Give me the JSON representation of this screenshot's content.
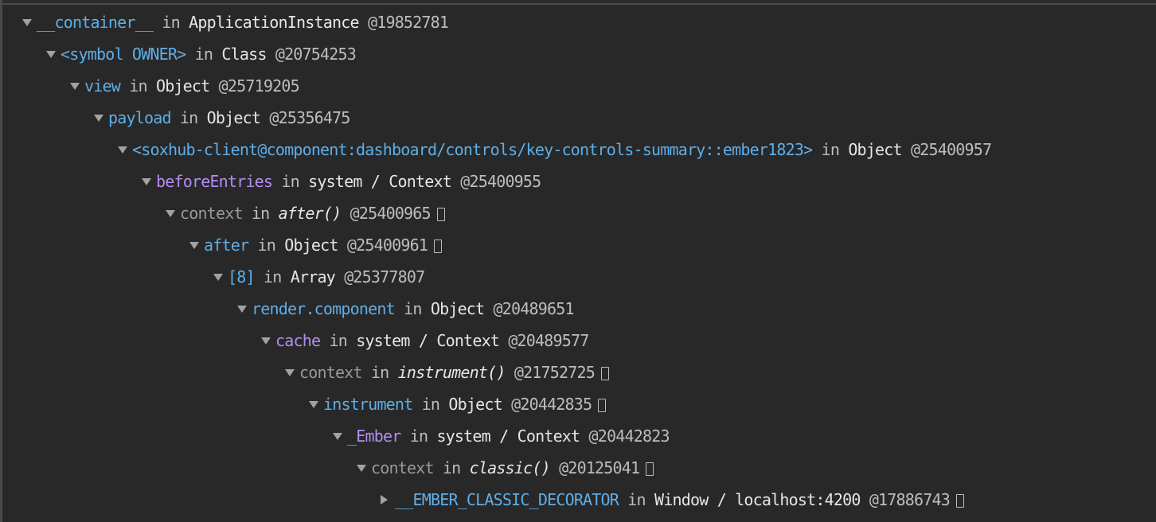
{
  "tree": [
    {
      "state": "open",
      "name": "__container__",
      "name_color": "blue",
      "in": "in",
      "type": "ApplicationInstance",
      "type_italic": false,
      "id": "@19852781",
      "reveal": false
    },
    {
      "state": "open",
      "name": "<symbol OWNER>",
      "name_color": "blue",
      "in": "in",
      "type": "Class",
      "type_italic": false,
      "id": "@20754253",
      "reveal": false
    },
    {
      "state": "open",
      "name": "view",
      "name_color": "blue",
      "in": "in",
      "type": "Object",
      "type_italic": false,
      "id": "@25719205",
      "reveal": false
    },
    {
      "state": "open",
      "name": "payload",
      "name_color": "blue",
      "in": "in",
      "type": "Object",
      "type_italic": false,
      "id": "@25356475",
      "reveal": false
    },
    {
      "state": "open",
      "name": "<soxhub-client@component:dashboard/controls/key-controls-summary::ember1823>",
      "name_color": "blue",
      "in": "in",
      "type": "Object",
      "type_italic": false,
      "id": "@25400957",
      "reveal": false
    },
    {
      "state": "open",
      "name": "beforeEntries",
      "name_color": "purple",
      "in": "in",
      "type": "system / Context",
      "type_italic": false,
      "id": "@25400955",
      "reveal": false
    },
    {
      "state": "open",
      "name": "context",
      "name_color": "gray",
      "in": "in",
      "type": "after()",
      "type_italic": true,
      "id": "@25400965",
      "reveal": true
    },
    {
      "state": "open",
      "name": "after",
      "name_color": "blue",
      "in": "in",
      "type": "Object",
      "type_italic": false,
      "id": "@25400961",
      "reveal": true
    },
    {
      "state": "open",
      "name": "[8]",
      "name_color": "blue",
      "in": "in",
      "type": "Array",
      "type_italic": false,
      "id": "@25377807",
      "reveal": false
    },
    {
      "state": "open",
      "name": "render.component",
      "name_color": "blue",
      "in": "in",
      "type": "Object",
      "type_italic": false,
      "id": "@20489651",
      "reveal": false
    },
    {
      "state": "open",
      "name": "cache",
      "name_color": "purple",
      "in": "in",
      "type": "system / Context",
      "type_italic": false,
      "id": "@20489577",
      "reveal": false
    },
    {
      "state": "open",
      "name": "context",
      "name_color": "gray",
      "in": "in",
      "type": "instrument()",
      "type_italic": true,
      "id": "@21752725",
      "reveal": true
    },
    {
      "state": "open",
      "name": "instrument",
      "name_color": "blue",
      "in": "in",
      "type": "Object",
      "type_italic": false,
      "id": "@20442835",
      "reveal": true
    },
    {
      "state": "open",
      "name": "_Ember",
      "name_color": "purple",
      "in": "in",
      "type": "system / Context",
      "type_italic": false,
      "id": "@20442823",
      "reveal": false
    },
    {
      "state": "open",
      "name": "context",
      "name_color": "gray",
      "in": "in",
      "type": "classic()",
      "type_italic": true,
      "id": "@20125041",
      "reveal": true
    },
    {
      "state": "closed",
      "name": "__EMBER_CLASSIC_DECORATOR",
      "name_color": "blue",
      "in": "in",
      "type": "Window / localhost:4200",
      "type_italic": false,
      "id": "@17886743",
      "reveal": true
    }
  ]
}
